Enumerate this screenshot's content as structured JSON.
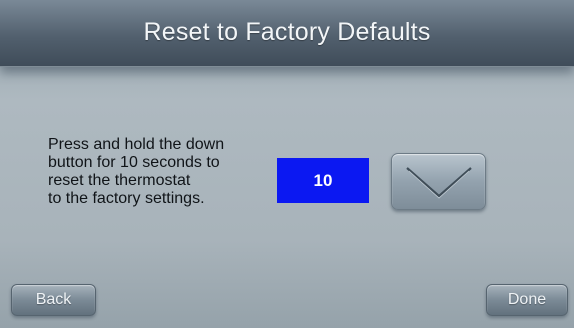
{
  "header": {
    "title": "Reset to Factory Defaults"
  },
  "instructions": {
    "lines": [
      "Press and hold the down",
      "button for 10 seconds to",
      "reset the thermostat",
      "to the factory settings."
    ]
  },
  "counter": {
    "value": "10",
    "color": "#0b18f2"
  },
  "down_button": {
    "icon": "chevron-down-icon"
  },
  "footer": {
    "back_label": "Back",
    "done_label": "Done"
  }
}
